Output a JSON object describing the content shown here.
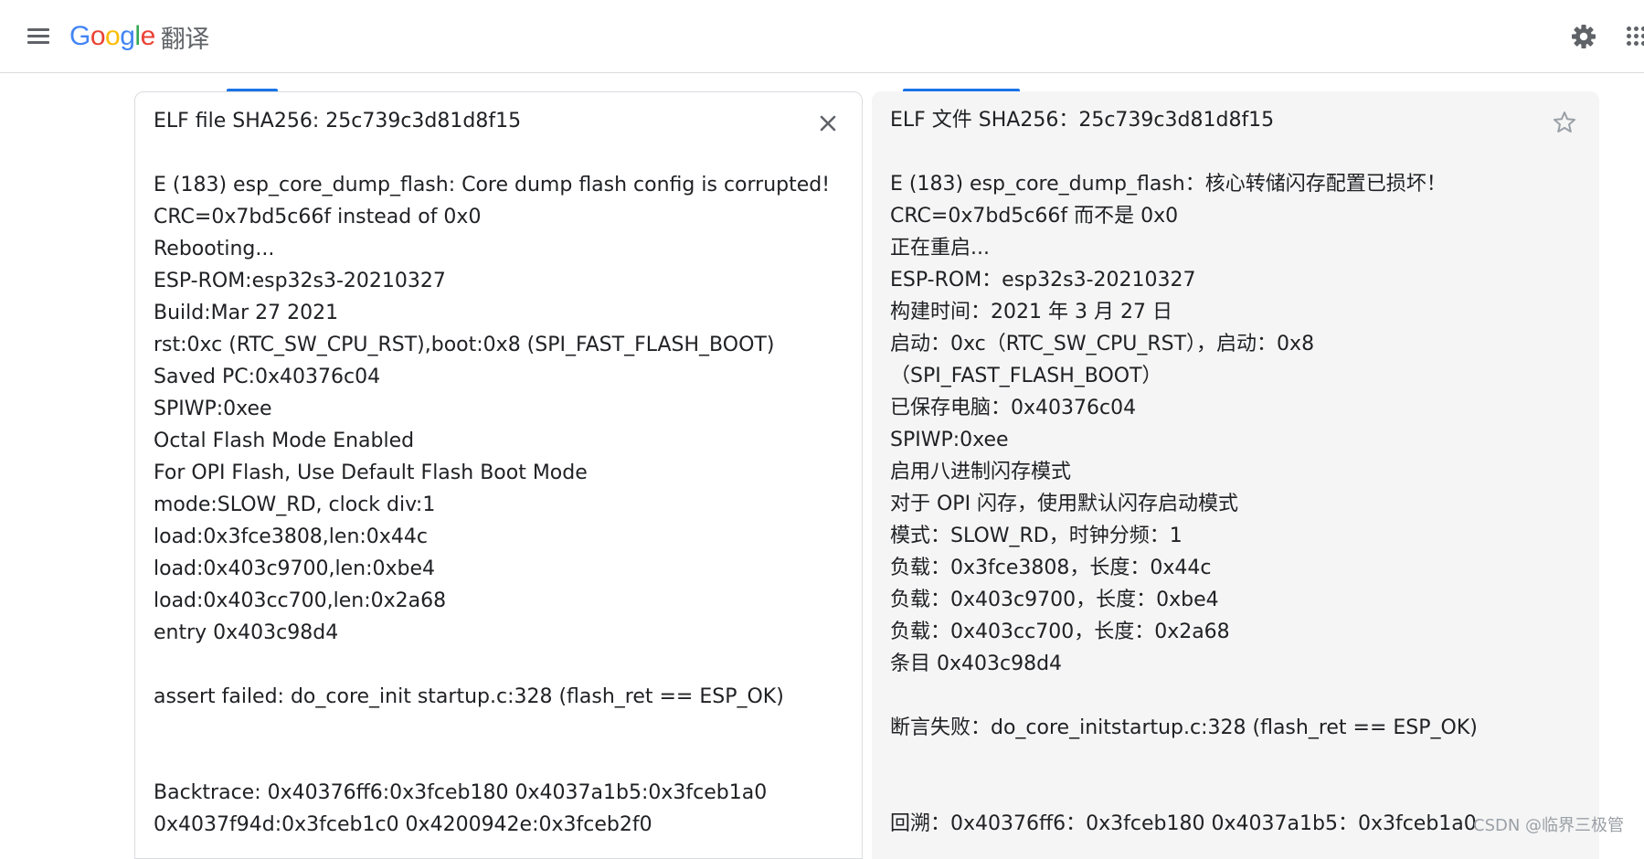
{
  "header": {
    "logo_letters": [
      "G",
      "o",
      "o",
      "g",
      "l",
      "e"
    ],
    "product_name": "翻译",
    "menu_icon": "hamburger-menu-icon",
    "settings_icon": "gear-icon",
    "apps_icon": "apps-grid-icon"
  },
  "source": {
    "close_icon": "close-icon",
    "lines": [
      "ELF file SHA256: 25c739c3d81d8f15",
      "",
      "E (183) esp_core_dump_flash: Core dump flash config is corrupted!",
      "CRC=0x7bd5c66f instead of 0x0",
      "Rebooting...",
      "ESP-ROM:esp32s3-20210327",
      "Build:Mar 27 2021",
      "rst:0xc (RTC_SW_CPU_RST),boot:0x8 (SPI_FAST_FLASH_BOOT)",
      "Saved PC:0x40376c04",
      "SPIWP:0xee",
      "Octal Flash Mode Enabled",
      "For OPI Flash, Use Default Flash Boot Mode",
      "mode:SLOW_RD, clock div:1",
      "load:0x3fce3808,len:0x44c",
      "load:0x403c9700,len:0xbe4",
      "load:0x403cc700,len:0x2a68",
      "entry 0x403c98d4",
      "",
      "assert failed: do_core_init startup.c:328 (flash_ret == ESP_OK)",
      "",
      "",
      "Backtrace: 0x40376ff6:0x3fceb180 0x4037a1b5:0x3fceb1a0",
      "0x4037f94d:0x3fceb1c0 0x4200942e:0x3fceb2f0"
    ]
  },
  "target": {
    "star_icon": "star-outline-icon",
    "lines": [
      "ELF 文件 SHA256：25c739c3d81d8f15",
      "",
      "E (183) esp_core_dump_flash：核心转储闪存配置已损坏！",
      "CRC=0x7bd5c66f 而不是 0x0",
      "正在重启...",
      "ESP-ROM：esp32s3-20210327",
      "构建时间：2021 年 3 月 27 日",
      "启动：0xc（RTC_SW_CPU_RST），启动：0x8",
      "（SPI_FAST_FLASH_BOOT）",
      "已保存电脑：0x40376c04",
      "SPIWP:0xee",
      "启用八进制闪存模式",
      "对于 OPI 闪存，使用默认闪存启动模式",
      "模式：SLOW_RD，时钟分频：1",
      "负载：0x3fce3808，长度：0x44c",
      "负载：0x403c9700，长度：0xbe4",
      "负载：0x403cc700，长度：0x2a68",
      "条目 0x403c98d4",
      "",
      "断言失败：do_core_initstartup.c:328 (flash_ret == ESP_OK)",
      "",
      "",
      "回溯：0x40376ff6：0x3fceb180 0x4037a1b5：0x3fceb1a0"
    ]
  },
  "watermark": "CSDN @临界三极管",
  "colors": {
    "accent": "#1a73e8",
    "text": "#202124",
    "icon": "#5f6368",
    "target_bg": "#f5f5f5"
  }
}
